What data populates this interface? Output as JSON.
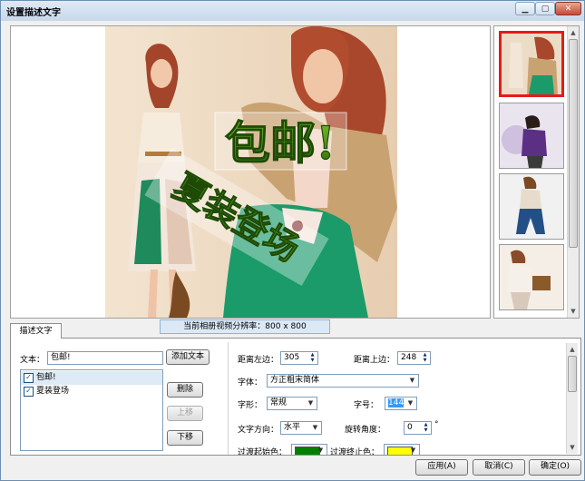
{
  "window": {
    "title": "设置描述文字"
  },
  "preview": {
    "resolution_label": "当前相册视频分辨率：800 x 800",
    "overlay_text_1": "包邮!",
    "overlay_text_2": "夏装登场"
  },
  "tabs": [
    {
      "label": "描述文字"
    }
  ],
  "text_panel": {
    "text_label": "文本：",
    "text_value": "包邮!",
    "add_button": "添加文本",
    "delete_button": "删除",
    "up_button": "上移",
    "down_button": "下移",
    "items": [
      {
        "label": "包邮!",
        "checked": true
      },
      {
        "label": "夏装登场",
        "checked": true
      }
    ]
  },
  "properties": {
    "left_label": "距离左边：",
    "left_value": "305",
    "top_label": "距离上边：",
    "top_value": "248",
    "font_label": "字体：",
    "font_value": "方正粗宋简体",
    "style_label": "字形：",
    "style_value": "常规",
    "size_label": "字号：",
    "size_value": "144",
    "direction_label": "文字方向：",
    "direction_value": "水平",
    "rotation_label": "旋转角度：",
    "rotation_value": "0",
    "rotation_unit": "°",
    "gradient_start_label": "过渡起始色：",
    "gradient_start_color": "#008000",
    "gradient_end_label": "过渡终止色：",
    "gradient_end_color": "#ffff00"
  },
  "footer": {
    "apply_button": "应用(A)",
    "cancel_button": "取消(C)",
    "ok_button": "确定(O)"
  },
  "colors": {
    "selected_thumb_border": "#e81919",
    "title_bar": "#c7d8ec",
    "overlay_green": "#3e8a12"
  },
  "icons": [
    "minimize-icon",
    "maximize-icon",
    "close-icon",
    "scroll-up-icon",
    "scroll-down-icon",
    "dropdown-arrow-icon",
    "spin-arrows-icon",
    "checkbox-checked-icon"
  ]
}
